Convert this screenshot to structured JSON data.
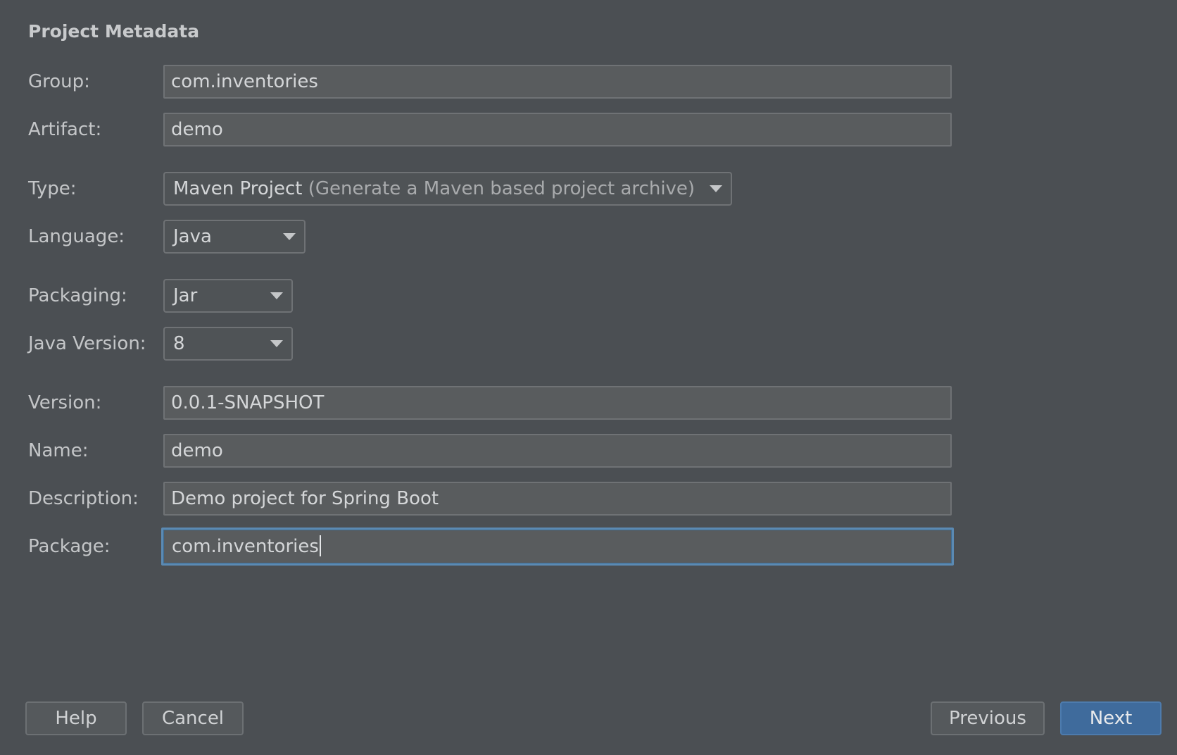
{
  "section_title": "Project Metadata",
  "fields": {
    "group": {
      "label": "Group:",
      "value": "com.inventories"
    },
    "artifact": {
      "label": "Artifact:",
      "value": "demo"
    },
    "type": {
      "label": "Type:",
      "value": "Maven Project",
      "hint": "(Generate a Maven based project archive)"
    },
    "language": {
      "label": "Language:",
      "value": "Java"
    },
    "packaging": {
      "label": "Packaging:",
      "value": "Jar"
    },
    "java_version": {
      "label": "Java Version:",
      "value": "8"
    },
    "version": {
      "label": "Version:",
      "value": "0.0.1-SNAPSHOT"
    },
    "name": {
      "label": "Name:",
      "value": "demo"
    },
    "description": {
      "label": "Description:",
      "value": "Demo project for Spring Boot"
    },
    "package": {
      "label": "Package:",
      "value": "com.inventories"
    }
  },
  "buttons": {
    "help": "Help",
    "cancel": "Cancel",
    "previous": "Previous",
    "next": "Next"
  },
  "colors": {
    "background": "#4b4f53",
    "field_bg": "#595c5e",
    "focus_border": "#5b8ab3",
    "primary_button": "#3f6b9c"
  },
  "icons": {
    "dropdown": "chevron-down-icon"
  }
}
